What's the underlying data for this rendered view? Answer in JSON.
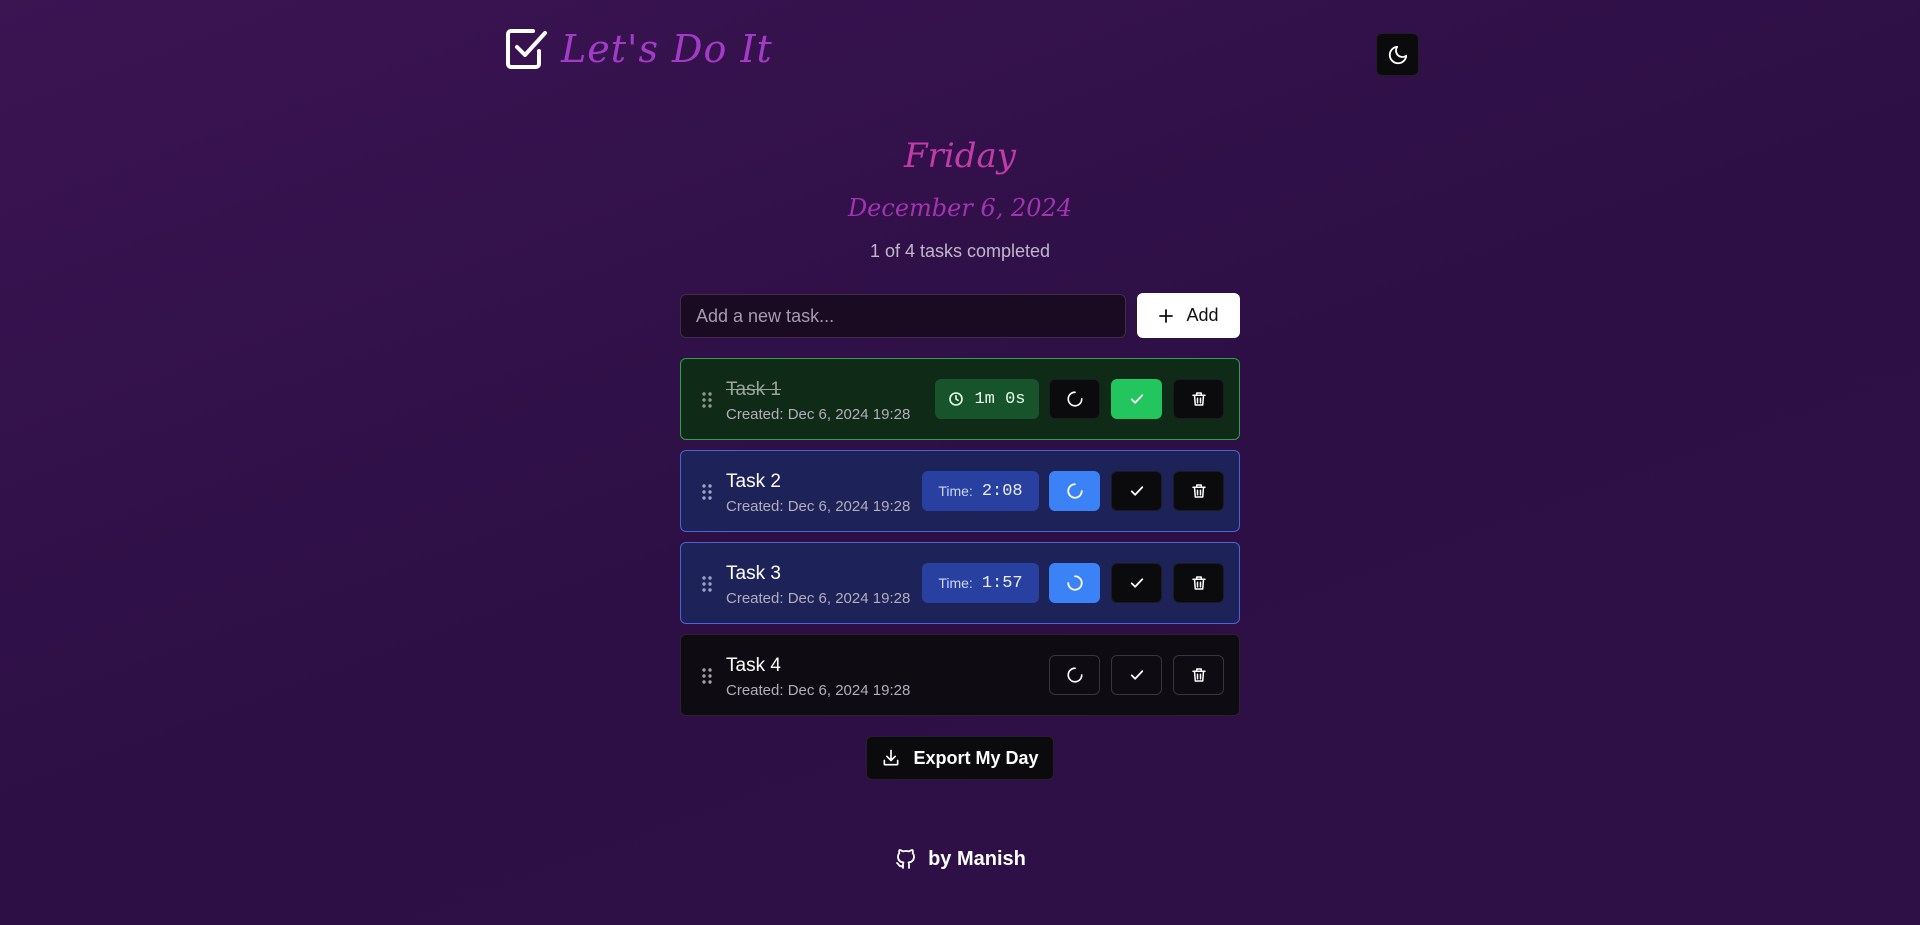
{
  "app": {
    "title": "Let's Do It",
    "logo_icon": "checkbox-icon",
    "theme_icon": "moon-icon"
  },
  "day": {
    "weekday": "Friday",
    "date": "December 6, 2024",
    "progress": "1 of 4 tasks completed"
  },
  "new_task": {
    "placeholder": "Add a new task...",
    "add_label": "Add"
  },
  "tasks": [
    {
      "name": "Task 1",
      "created": "Created: Dec 6, 2024 19:28",
      "status": "completed",
      "timer": "1m 0s"
    },
    {
      "name": "Task 2",
      "created": "Created: Dec 6, 2024 19:28",
      "status": "in-progress",
      "timer_label": "Time:",
      "timer": "2:08"
    },
    {
      "name": "Task 3",
      "created": "Created: Dec 6, 2024 19:28",
      "status": "in-progress",
      "timer_label": "Time:",
      "timer": "1:57"
    },
    {
      "name": "Task 4",
      "created": "Created: Dec 6, 2024 19:28",
      "status": "pending"
    }
  ],
  "export": {
    "label": "Export My Day"
  },
  "footer": {
    "text": "by Manish",
    "icon": "github-icon"
  },
  "colors": {
    "completed": "#22c55e",
    "in_progress": "#3b82f6",
    "title": "#a43bc8",
    "weekday": "#c13ba9"
  }
}
